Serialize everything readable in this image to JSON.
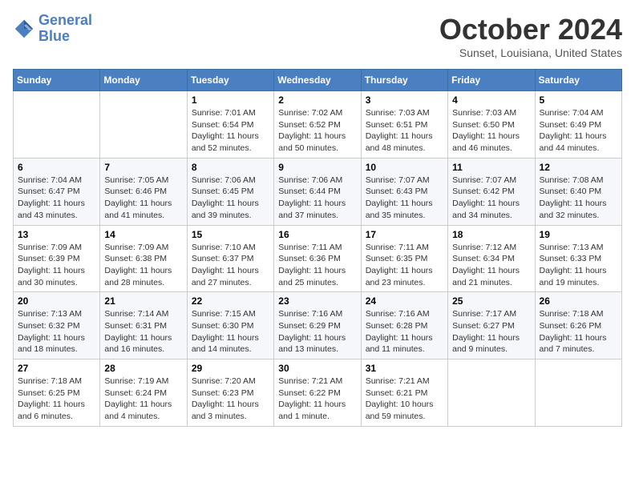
{
  "header": {
    "logo_line1": "General",
    "logo_line2": "Blue",
    "month": "October 2024",
    "location": "Sunset, Louisiana, United States"
  },
  "days_of_week": [
    "Sunday",
    "Monday",
    "Tuesday",
    "Wednesday",
    "Thursday",
    "Friday",
    "Saturday"
  ],
  "weeks": [
    [
      {
        "day": "",
        "sunrise": "",
        "sunset": "",
        "daylight": ""
      },
      {
        "day": "",
        "sunrise": "",
        "sunset": "",
        "daylight": ""
      },
      {
        "day": "1",
        "sunrise": "Sunrise: 7:01 AM",
        "sunset": "Sunset: 6:54 PM",
        "daylight": "Daylight: 11 hours and 52 minutes."
      },
      {
        "day": "2",
        "sunrise": "Sunrise: 7:02 AM",
        "sunset": "Sunset: 6:52 PM",
        "daylight": "Daylight: 11 hours and 50 minutes."
      },
      {
        "day": "3",
        "sunrise": "Sunrise: 7:03 AM",
        "sunset": "Sunset: 6:51 PM",
        "daylight": "Daylight: 11 hours and 48 minutes."
      },
      {
        "day": "4",
        "sunrise": "Sunrise: 7:03 AM",
        "sunset": "Sunset: 6:50 PM",
        "daylight": "Daylight: 11 hours and 46 minutes."
      },
      {
        "day": "5",
        "sunrise": "Sunrise: 7:04 AM",
        "sunset": "Sunset: 6:49 PM",
        "daylight": "Daylight: 11 hours and 44 minutes."
      }
    ],
    [
      {
        "day": "6",
        "sunrise": "Sunrise: 7:04 AM",
        "sunset": "Sunset: 6:47 PM",
        "daylight": "Daylight: 11 hours and 43 minutes."
      },
      {
        "day": "7",
        "sunrise": "Sunrise: 7:05 AM",
        "sunset": "Sunset: 6:46 PM",
        "daylight": "Daylight: 11 hours and 41 minutes."
      },
      {
        "day": "8",
        "sunrise": "Sunrise: 7:06 AM",
        "sunset": "Sunset: 6:45 PM",
        "daylight": "Daylight: 11 hours and 39 minutes."
      },
      {
        "day": "9",
        "sunrise": "Sunrise: 7:06 AM",
        "sunset": "Sunset: 6:44 PM",
        "daylight": "Daylight: 11 hours and 37 minutes."
      },
      {
        "day": "10",
        "sunrise": "Sunrise: 7:07 AM",
        "sunset": "Sunset: 6:43 PM",
        "daylight": "Daylight: 11 hours and 35 minutes."
      },
      {
        "day": "11",
        "sunrise": "Sunrise: 7:07 AM",
        "sunset": "Sunset: 6:42 PM",
        "daylight": "Daylight: 11 hours and 34 minutes."
      },
      {
        "day": "12",
        "sunrise": "Sunrise: 7:08 AM",
        "sunset": "Sunset: 6:40 PM",
        "daylight": "Daylight: 11 hours and 32 minutes."
      }
    ],
    [
      {
        "day": "13",
        "sunrise": "Sunrise: 7:09 AM",
        "sunset": "Sunset: 6:39 PM",
        "daylight": "Daylight: 11 hours and 30 minutes."
      },
      {
        "day": "14",
        "sunrise": "Sunrise: 7:09 AM",
        "sunset": "Sunset: 6:38 PM",
        "daylight": "Daylight: 11 hours and 28 minutes."
      },
      {
        "day": "15",
        "sunrise": "Sunrise: 7:10 AM",
        "sunset": "Sunset: 6:37 PM",
        "daylight": "Daylight: 11 hours and 27 minutes."
      },
      {
        "day": "16",
        "sunrise": "Sunrise: 7:11 AM",
        "sunset": "Sunset: 6:36 PM",
        "daylight": "Daylight: 11 hours and 25 minutes."
      },
      {
        "day": "17",
        "sunrise": "Sunrise: 7:11 AM",
        "sunset": "Sunset: 6:35 PM",
        "daylight": "Daylight: 11 hours and 23 minutes."
      },
      {
        "day": "18",
        "sunrise": "Sunrise: 7:12 AM",
        "sunset": "Sunset: 6:34 PM",
        "daylight": "Daylight: 11 hours and 21 minutes."
      },
      {
        "day": "19",
        "sunrise": "Sunrise: 7:13 AM",
        "sunset": "Sunset: 6:33 PM",
        "daylight": "Daylight: 11 hours and 19 minutes."
      }
    ],
    [
      {
        "day": "20",
        "sunrise": "Sunrise: 7:13 AM",
        "sunset": "Sunset: 6:32 PM",
        "daylight": "Daylight: 11 hours and 18 minutes."
      },
      {
        "day": "21",
        "sunrise": "Sunrise: 7:14 AM",
        "sunset": "Sunset: 6:31 PM",
        "daylight": "Daylight: 11 hours and 16 minutes."
      },
      {
        "day": "22",
        "sunrise": "Sunrise: 7:15 AM",
        "sunset": "Sunset: 6:30 PM",
        "daylight": "Daylight: 11 hours and 14 minutes."
      },
      {
        "day": "23",
        "sunrise": "Sunrise: 7:16 AM",
        "sunset": "Sunset: 6:29 PM",
        "daylight": "Daylight: 11 hours and 13 minutes."
      },
      {
        "day": "24",
        "sunrise": "Sunrise: 7:16 AM",
        "sunset": "Sunset: 6:28 PM",
        "daylight": "Daylight: 11 hours and 11 minutes."
      },
      {
        "day": "25",
        "sunrise": "Sunrise: 7:17 AM",
        "sunset": "Sunset: 6:27 PM",
        "daylight": "Daylight: 11 hours and 9 minutes."
      },
      {
        "day": "26",
        "sunrise": "Sunrise: 7:18 AM",
        "sunset": "Sunset: 6:26 PM",
        "daylight": "Daylight: 11 hours and 7 minutes."
      }
    ],
    [
      {
        "day": "27",
        "sunrise": "Sunrise: 7:18 AM",
        "sunset": "Sunset: 6:25 PM",
        "daylight": "Daylight: 11 hours and 6 minutes."
      },
      {
        "day": "28",
        "sunrise": "Sunrise: 7:19 AM",
        "sunset": "Sunset: 6:24 PM",
        "daylight": "Daylight: 11 hours and 4 minutes."
      },
      {
        "day": "29",
        "sunrise": "Sunrise: 7:20 AM",
        "sunset": "Sunset: 6:23 PM",
        "daylight": "Daylight: 11 hours and 3 minutes."
      },
      {
        "day": "30",
        "sunrise": "Sunrise: 7:21 AM",
        "sunset": "Sunset: 6:22 PM",
        "daylight": "Daylight: 11 hours and 1 minute."
      },
      {
        "day": "31",
        "sunrise": "Sunrise: 7:21 AM",
        "sunset": "Sunset: 6:21 PM",
        "daylight": "Daylight: 10 hours and 59 minutes."
      },
      {
        "day": "",
        "sunrise": "",
        "sunset": "",
        "daylight": ""
      },
      {
        "day": "",
        "sunrise": "",
        "sunset": "",
        "daylight": ""
      }
    ]
  ]
}
